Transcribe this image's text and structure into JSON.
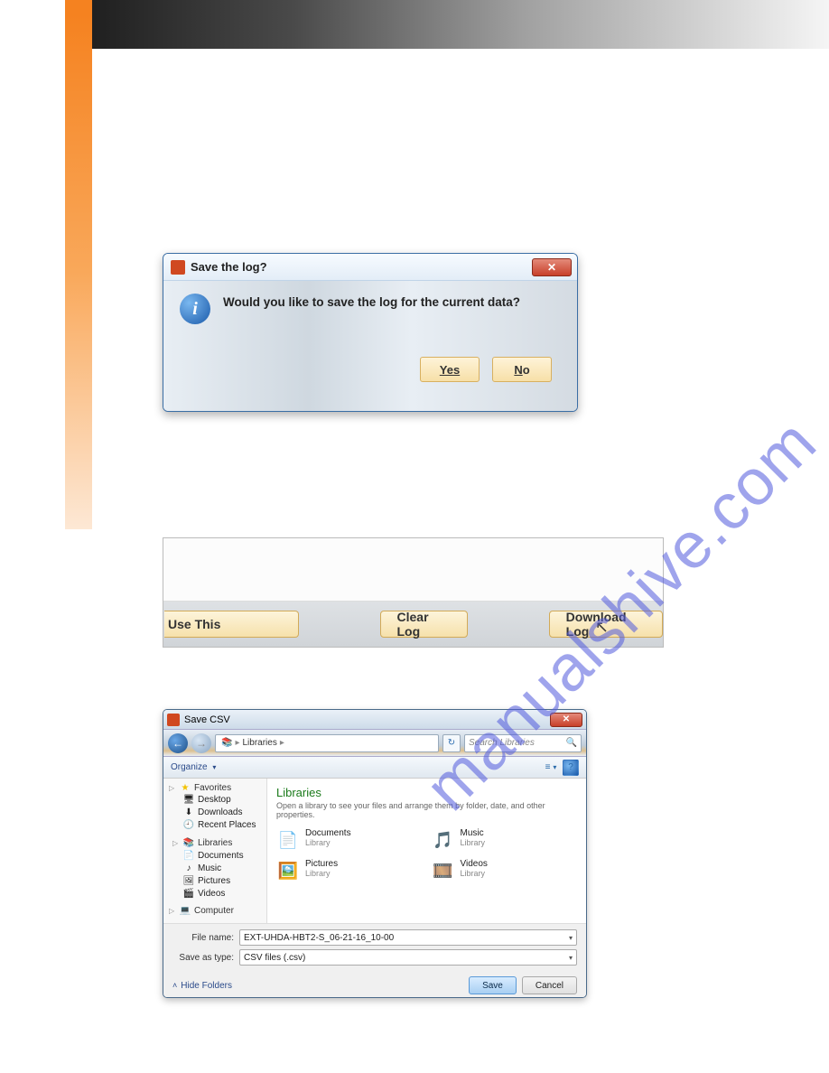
{
  "watermark_text": "manualshive.com",
  "dialog1": {
    "title": "Save the log?",
    "message": "Would you like to save the log for the current data?",
    "yes_label": "Yes",
    "no_label": "No",
    "no_underline": "N",
    "no_rest": "o",
    "close_glyph": "✕"
  },
  "panel2": {
    "use_this_label": "Use This",
    "clear_log_label": "Clear Log",
    "download_log_label": "Download Log"
  },
  "dialog3": {
    "title": "Save CSV",
    "breadcrumb_root_glyph": "▸",
    "breadcrumb_item": "Libraries",
    "breadcrumb_caret": "▸",
    "refresh_glyph": "↻",
    "search_placeholder": "Search Libraries",
    "organize_label": "Organize",
    "heading": "Libraries",
    "subheading": "Open a library to see your files and arrange them by folder, date, and other properties.",
    "sidebar": {
      "favorites": {
        "label": "Favorites",
        "items": [
          "Desktop",
          "Downloads",
          "Recent Places"
        ]
      },
      "libraries": {
        "label": "Libraries",
        "items": [
          "Documents",
          "Music",
          "Pictures",
          "Videos"
        ]
      },
      "computer": {
        "label": "Computer"
      }
    },
    "libs": {
      "documents": {
        "name": "Documents",
        "type": "Library",
        "glyph": "📄"
      },
      "music": {
        "name": "Music",
        "type": "Library",
        "glyph": "🎵"
      },
      "pictures": {
        "name": "Pictures",
        "type": "Library",
        "glyph": "🖼️"
      },
      "videos": {
        "name": "Videos",
        "type": "Library",
        "glyph": "🎞️"
      }
    },
    "file_name_label": "File name:",
    "file_name_value": "EXT-UHDA-HBT2-S_06-21-16_10-00",
    "save_type_label": "Save as type:",
    "save_type_value": "CSV files (.csv)",
    "hide_folders_label": "Hide Folders",
    "save_label": "Save",
    "cancel_label": "Cancel",
    "close_glyph": "✕",
    "help_glyph": "?",
    "view_glyph": "≡",
    "dropdown_caret": "▾",
    "back_glyph": "←",
    "fwd_glyph": "→",
    "favorites_star": "★",
    "lib_glyph": "📚",
    "desktop_glyph": "🖥",
    "downloads_glyph": "⬇",
    "recent_glyph": "🕘",
    "doc_glyph": "📄",
    "music_glyph": "♪",
    "pic_glyph": "🖼",
    "vid_glyph": "🎬",
    "computer_glyph": "💻",
    "search_icon": "🔍",
    "chev_up": "˄"
  }
}
